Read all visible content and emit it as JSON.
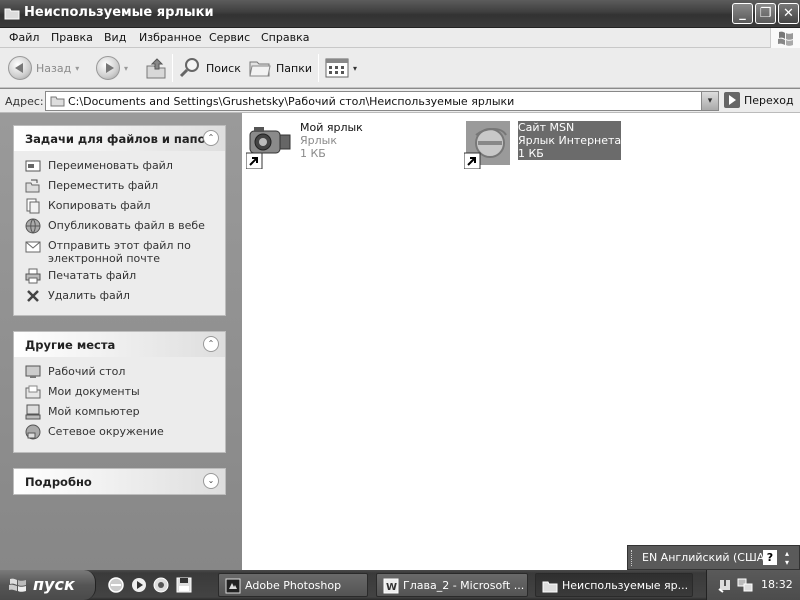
{
  "window": {
    "title": "Неиспользуемые ярлыки",
    "min_label": "_",
    "max_label": "❐",
    "close_label": "✕"
  },
  "menu": [
    "Файл",
    "Правка",
    "Вид",
    "Избранное",
    "Сервис",
    "Справка"
  ],
  "toolbar": {
    "back_label": "Назад",
    "search_label": "Поиск",
    "folders_label": "Папки",
    "view_dropdown": "▾",
    "back_dropdown": "▾",
    "fwd_dropdown": "▾"
  },
  "address": {
    "label": "Адрес:",
    "value": "C:\\Documents and Settings\\Grushetsky\\Рабочий стол\\Неиспользуемые ярлыки",
    "dropdown": "▾",
    "go_label": "Переход"
  },
  "panes": {
    "tasks": {
      "title": "Задачи для файлов и папок",
      "collapse_icon": "⌃",
      "items": [
        {
          "label": "Переименовать файл",
          "icon": "rename-icon"
        },
        {
          "label": "Переместить файл",
          "icon": "move-icon"
        },
        {
          "label": "Копировать файл",
          "icon": "copy-icon"
        },
        {
          "label": "Опубликовать файл в вебе",
          "icon": "web-publish-icon"
        },
        {
          "label": "Отправить этот файл по электронной почте",
          "icon": "email-icon"
        },
        {
          "label": "Печатать файл",
          "icon": "printer-icon"
        },
        {
          "label": "Удалить файл",
          "icon": "delete-icon"
        }
      ]
    },
    "places": {
      "title": "Другие места",
      "collapse_icon": "⌃",
      "items": [
        {
          "label": "Рабочий стол",
          "icon": "desktop-icon"
        },
        {
          "label": "Мои документы",
          "icon": "my-documents-icon"
        },
        {
          "label": "Мой компьютер",
          "icon": "my-computer-icon"
        },
        {
          "label": "Сетевое окружение",
          "icon": "network-icon"
        }
      ]
    },
    "details": {
      "title": "Подробно",
      "expand_icon": "⌄"
    }
  },
  "files": [
    {
      "name": "Мой ярлык",
      "type": "Ярлык",
      "size": "1 КБ",
      "icon": "camera-shortcut-icon",
      "selected": false
    },
    {
      "name": "Сайт MSN",
      "type": "Ярлык Интернета",
      "size": "1 КБ",
      "icon": "internet-shortcut-icon",
      "selected": true
    }
  ],
  "langbar": {
    "text": "EN Английский (США)",
    "help": "?"
  },
  "taskbar": {
    "start_label": "пуск",
    "tasks": [
      {
        "label": "Adobe Photoshop",
        "icon": "photoshop-icon",
        "active": false
      },
      {
        "label": "Глава_2 - Microsoft ...",
        "icon": "word-icon",
        "active": false
      },
      {
        "label": "Неиспользуемые яр...",
        "icon": "folder-icon",
        "active": true
      }
    ],
    "clock": "18:32"
  }
}
